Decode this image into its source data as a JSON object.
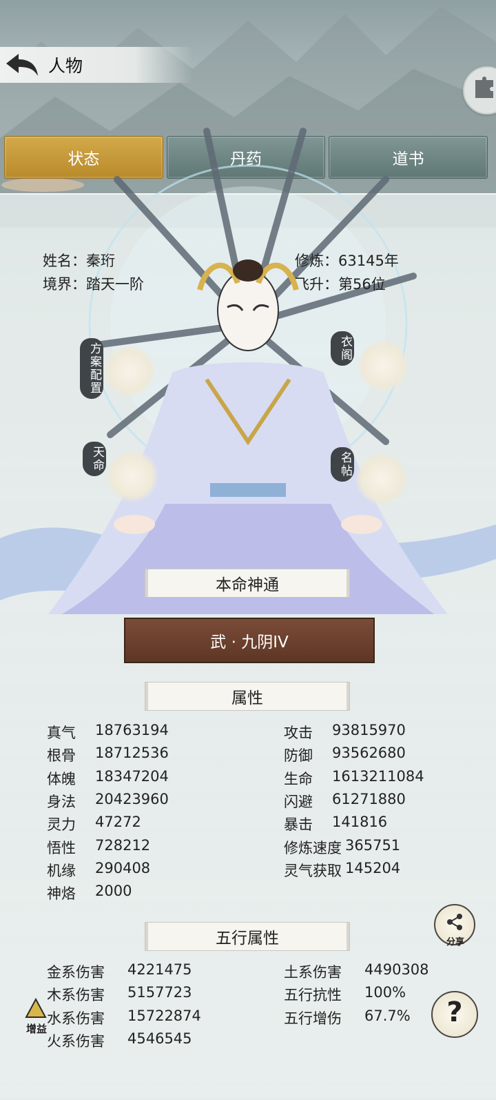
{
  "header": {
    "title": "人物"
  },
  "tabs": [
    {
      "label": "状态",
      "active": true
    },
    {
      "label": "丹药",
      "active": false
    },
    {
      "label": "道书",
      "active": false
    }
  ],
  "profile": {
    "name_label": "姓名：秦珩",
    "realm_label": "境界：踏天一阶",
    "cultivation_label": "修炼：63145年",
    "ascension_label": "飞升：第56位"
  },
  "side_buttons": {
    "plan": "方案配置",
    "wardrobe": "衣阁",
    "fate": "天命",
    "card": "名帖"
  },
  "innate": {
    "heading": "本命神通",
    "skill": "武 · 九阴IV"
  },
  "attributes": {
    "heading": "属性",
    "left": [
      {
        "label": "真气",
        "value": "18763194"
      },
      {
        "label": "根骨",
        "value": "18712536"
      },
      {
        "label": "体魄",
        "value": "18347204"
      },
      {
        "label": "身法",
        "value": "20423960"
      },
      {
        "label": "灵力",
        "value": "47272"
      },
      {
        "label": "悟性",
        "value": "728212"
      },
      {
        "label": "机缘",
        "value": "290408"
      },
      {
        "label": "神烙",
        "value": "2000"
      }
    ],
    "right": [
      {
        "label": "攻击",
        "value": "93815970"
      },
      {
        "label": "防御",
        "value": "93562680"
      },
      {
        "label": "生命",
        "value": "1613211084"
      },
      {
        "label": "闪避",
        "value": "61271880"
      },
      {
        "label": "暴击",
        "value": "141816"
      },
      {
        "label": "修炼速度",
        "value": "365751"
      },
      {
        "label": "灵气获取",
        "value": "145204"
      }
    ]
  },
  "elements": {
    "heading": "五行属性",
    "left": [
      {
        "label": "金系伤害",
        "value": "4221475"
      },
      {
        "label": "木系伤害",
        "value": "5157723"
      },
      {
        "label": "水系伤害",
        "value": "15722874"
      },
      {
        "label": "火系伤害",
        "value": "4546545"
      }
    ],
    "right": [
      {
        "label": "土系伤害",
        "value": "4490308"
      },
      {
        "label": "五行抗性",
        "value": "100%"
      },
      {
        "label": "五行增伤",
        "value": "67.7%"
      }
    ]
  },
  "float": {
    "share": "分享",
    "help": "?",
    "boost": "增益"
  },
  "colors": {
    "tab_active": "#c89c3a",
    "tab_inactive": "#6b8381",
    "skill_button": "#6b4030"
  }
}
